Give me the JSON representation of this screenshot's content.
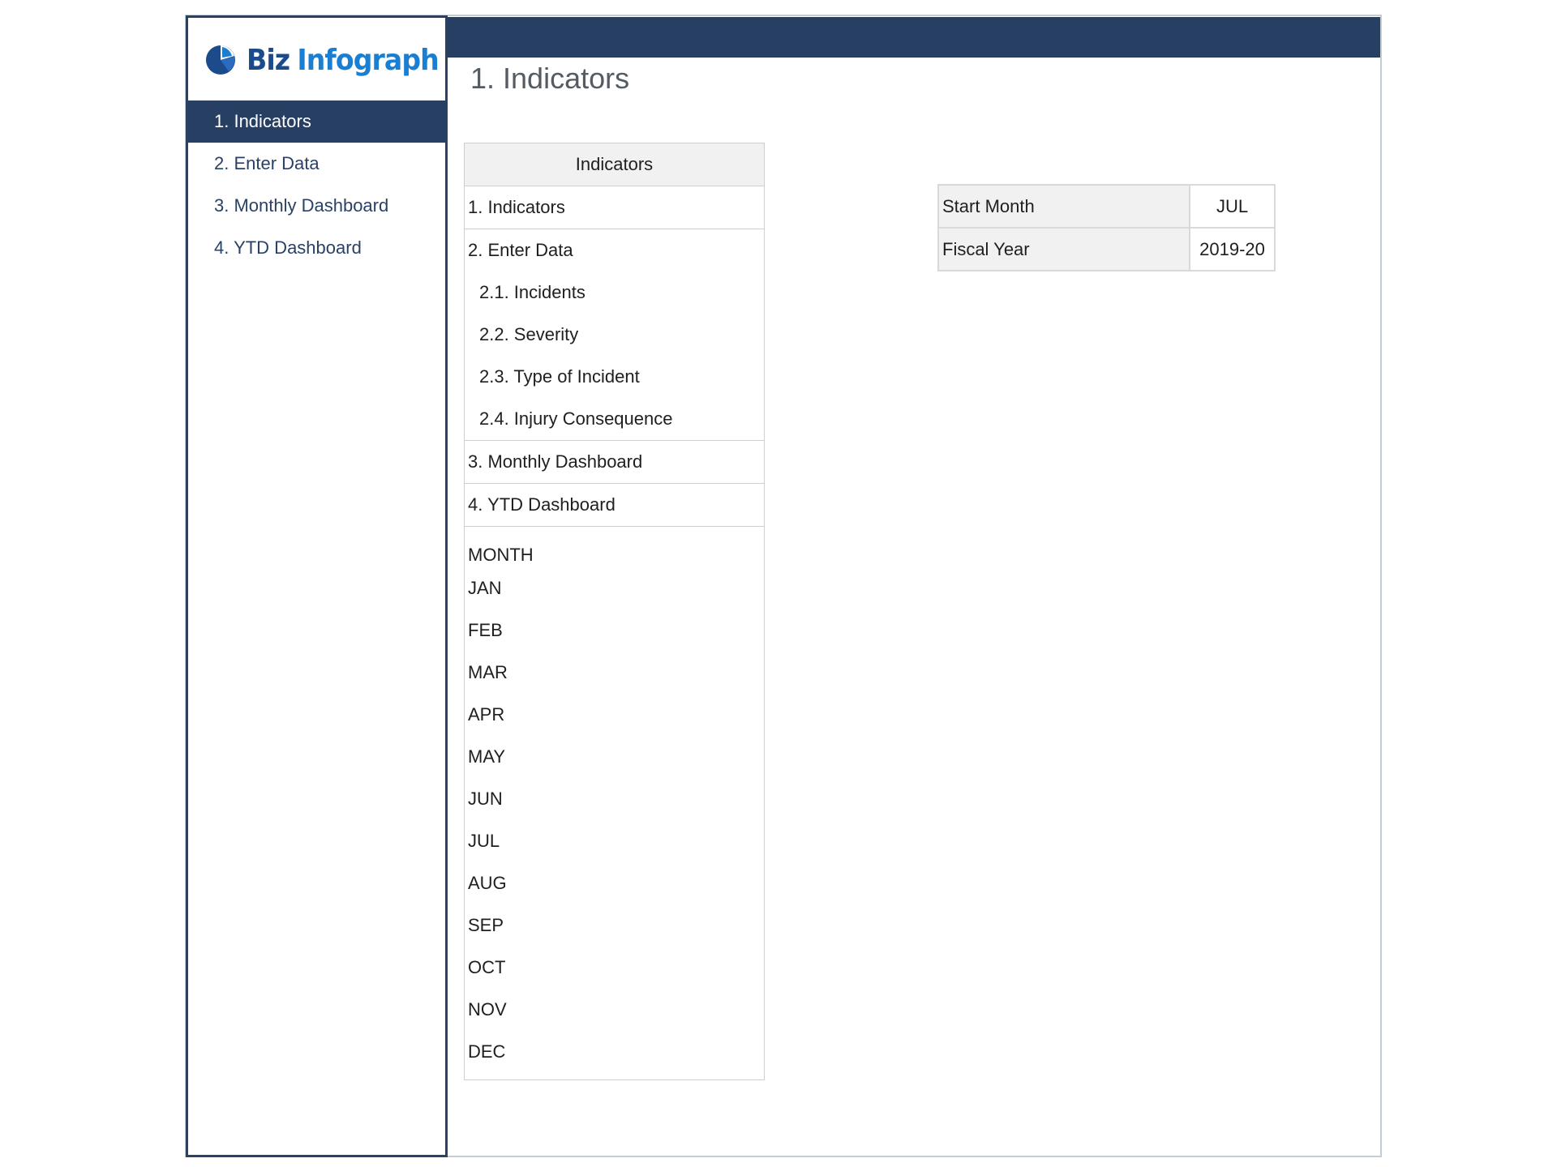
{
  "brand": {
    "name_part1": "Biz",
    "name_part2": "Infograph",
    "colors": {
      "dark": "#1c4b8c",
      "light": "#1a7fd2"
    },
    "icon": "pie-chart-icon"
  },
  "sidebar": {
    "items": [
      {
        "label": "1. Indicators",
        "active": true
      },
      {
        "label": "2. Enter Data",
        "active": false
      },
      {
        "label": "3. Monthly Dashboard",
        "active": false
      },
      {
        "label": "4. YTD Dashboard",
        "active": false
      }
    ]
  },
  "header": {
    "bar_color": "#263f63",
    "title": "1. Indicators"
  },
  "indicators_table": {
    "header": "Indicators",
    "rows": [
      {
        "label": "1. Indicators"
      },
      {
        "label": "2. Enter Data"
      },
      {
        "label": "2.1. Incidents"
      },
      {
        "label": "2.2. Severity"
      },
      {
        "label": "2.3. Type of Incident"
      },
      {
        "label": "2.4. Injury Consequence"
      },
      {
        "label": "3. Monthly Dashboard"
      },
      {
        "label": "4. YTD Dashboard"
      }
    ],
    "month_header": "MONTH",
    "months": [
      "JAN",
      "FEB",
      "MAR",
      "APR",
      "MAY",
      "JUN",
      "JUL",
      "AUG",
      "SEP",
      "OCT",
      "NOV",
      "DEC"
    ]
  },
  "settings": {
    "start_month_label": "Start Month",
    "start_month_value": "JUL",
    "fiscal_year_label": "Fiscal Year",
    "fiscal_year_value": "2019-20"
  }
}
